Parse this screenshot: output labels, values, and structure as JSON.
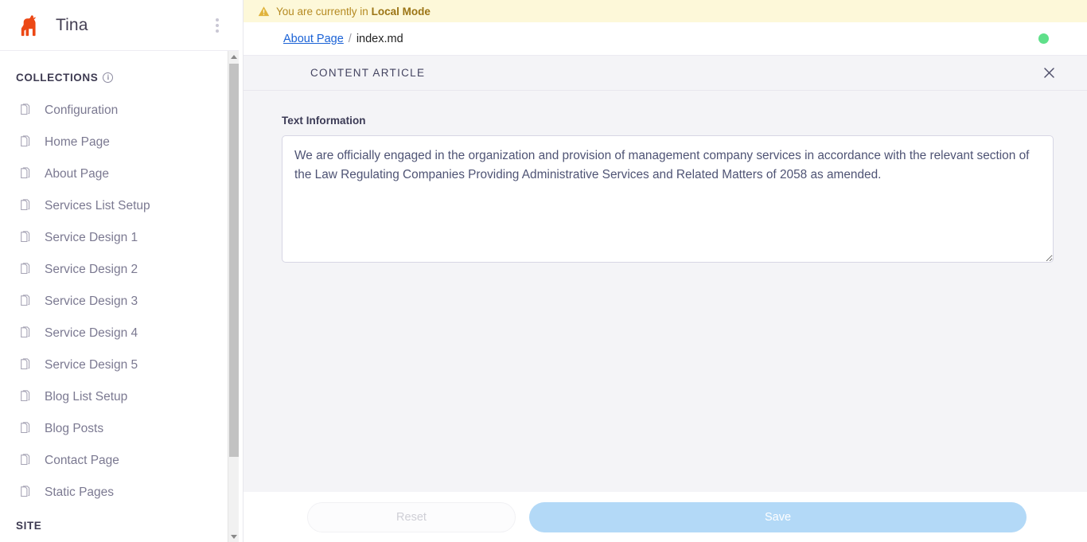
{
  "sidebar": {
    "brand": "Tina",
    "logo_icon": "llama-logo-icon",
    "logo_color": "#ec4815",
    "menu_icon": "kebab-menu-icon",
    "collections_label": "COLLECTIONS",
    "collections_info_icon": "info-icon",
    "info_glyph": "i",
    "site_label": "SITE",
    "item_icon": "document-copy-icon",
    "items": [
      {
        "label": "Configuration"
      },
      {
        "label": "Home Page"
      },
      {
        "label": "About Page"
      },
      {
        "label": "Services List Setup"
      },
      {
        "label": "Service Design 1"
      },
      {
        "label": "Service Design 2"
      },
      {
        "label": "Service Design 3"
      },
      {
        "label": "Service Design 4"
      },
      {
        "label": "Service Design 5"
      },
      {
        "label": "Blog List Setup"
      },
      {
        "label": "Blog Posts"
      },
      {
        "label": "Contact Page"
      },
      {
        "label": "Static Pages"
      }
    ],
    "scrollbar": {
      "up_icon": "scroll-up-arrow-icon",
      "down_icon": "scroll-down-arrow-icon"
    }
  },
  "banner": {
    "icon": "warning-triangle-icon",
    "text_prefix": "You are currently in ",
    "mode": "Local Mode",
    "background": "#fdf8d9",
    "text_color": "#b58a22"
  },
  "breadcrumb": {
    "parent": "About Page",
    "separator": "/",
    "current": "index.md",
    "link_color": "#1a62d6",
    "status_dot_name": "status-indicator-dot",
    "status_dot_color": "#5fe08a"
  },
  "form": {
    "title": "CONTENT ARTICLE",
    "close_icon": "close-x-icon",
    "fields": [
      {
        "label": "Text Information",
        "value": "We are officially engaged in the organization and provision of management company services in accordance with the relevant section of the Law Regulating Companies Providing Administrative Services and Related Matters of 2058 as amended.",
        "placeholder": ""
      }
    ],
    "footer": {
      "reset_label": "Reset",
      "save_label": "Save",
      "save_color": "#b3d9f7"
    }
  }
}
